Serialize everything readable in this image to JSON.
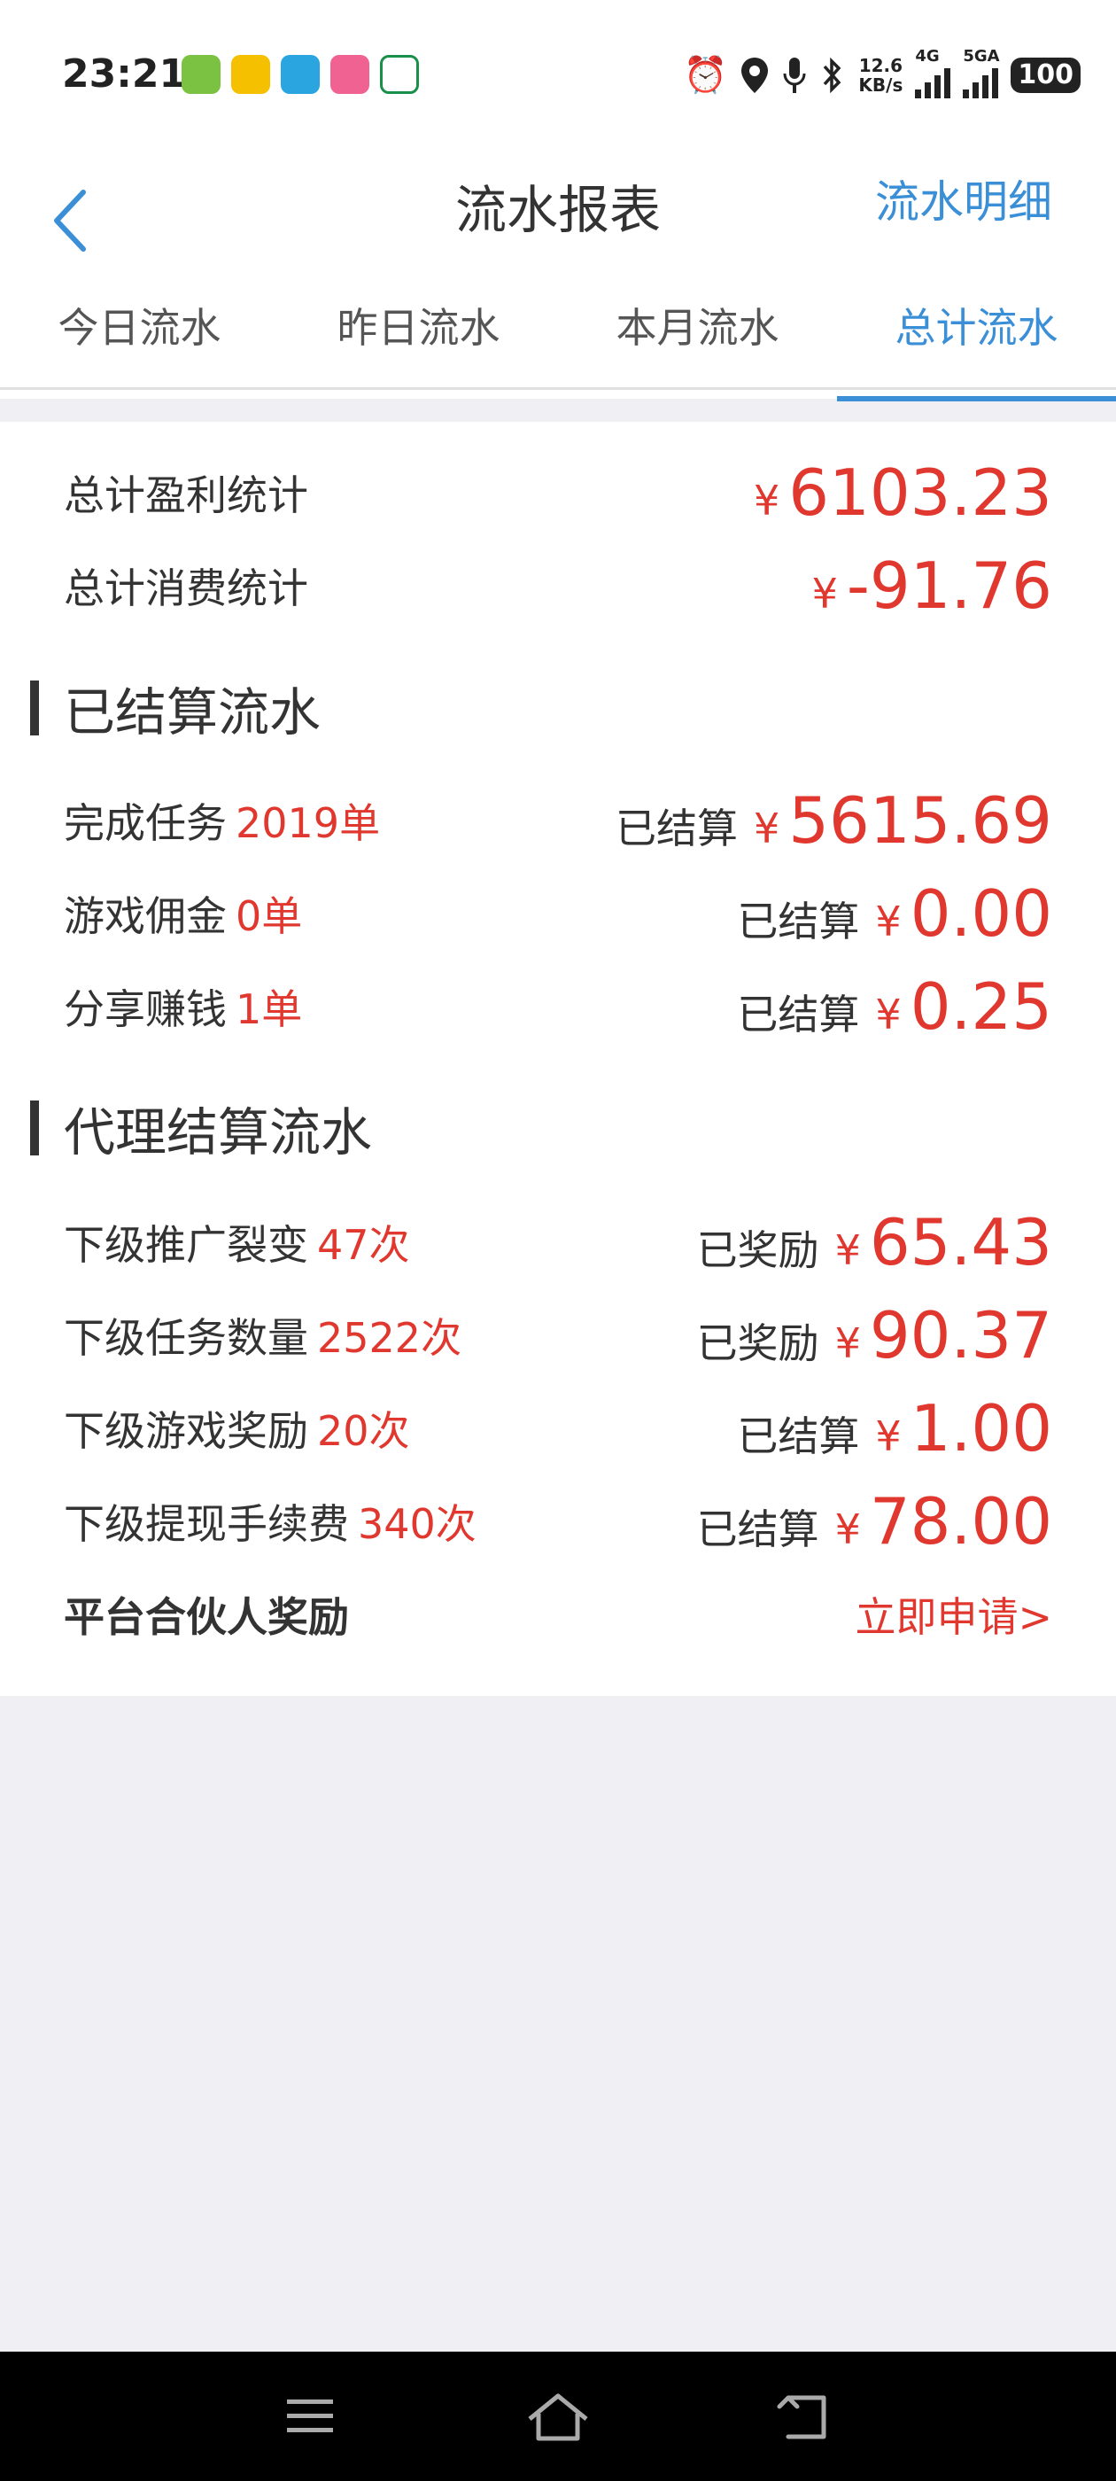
{
  "status_bar": {
    "time": "23:21",
    "net_speed_value": "12.6",
    "net_speed_unit": "KB/s",
    "signal_1": "4G",
    "signal_2": "5GA",
    "battery": "100"
  },
  "header": {
    "title": "流水报表",
    "detail_link": "流水明细"
  },
  "tabs": [
    "今日流水",
    "昨日流水",
    "本月流水",
    "总计流水"
  ],
  "active_tab": 3,
  "colors": {
    "accent": "#3a8fd6",
    "money": "#e0382f"
  },
  "summary": {
    "profit_label": "总计盈利统计",
    "profit_currency": "¥",
    "profit_value": "6103.23",
    "spend_label": "总计消费统计",
    "spend_currency": "¥",
    "spend_value": "-91.76"
  },
  "settled": {
    "title": "已结算流水",
    "rows": [
      {
        "label": "完成任务",
        "count": "2019单",
        "status": "已结算",
        "currency": "¥",
        "amount": "5615.69"
      },
      {
        "label": "游戏佣金",
        "count": "0单",
        "status": "已结算",
        "currency": "¥",
        "amount": "0.00"
      },
      {
        "label": "分享赚钱",
        "count": "1单",
        "status": "已结算",
        "currency": "¥",
        "amount": "0.25"
      }
    ]
  },
  "agent": {
    "title": "代理结算流水",
    "rows": [
      {
        "label": "下级推广裂变",
        "count": "47次",
        "status": "已奖励",
        "currency": "¥",
        "amount": "65.43"
      },
      {
        "label": "下级任务数量",
        "count": "2522次",
        "status": "已奖励",
        "currency": "¥",
        "amount": "90.37"
      },
      {
        "label": "下级游戏奖励",
        "count": "20次",
        "status": "已结算",
        "currency": "¥",
        "amount": "1.00"
      },
      {
        "label": "下级提现手续费",
        "count": "340次",
        "status": "已结算",
        "currency": "¥",
        "amount": "78.00"
      }
    ],
    "partner_label": "平台合伙人奖励",
    "apply_label": "立即申请>"
  }
}
